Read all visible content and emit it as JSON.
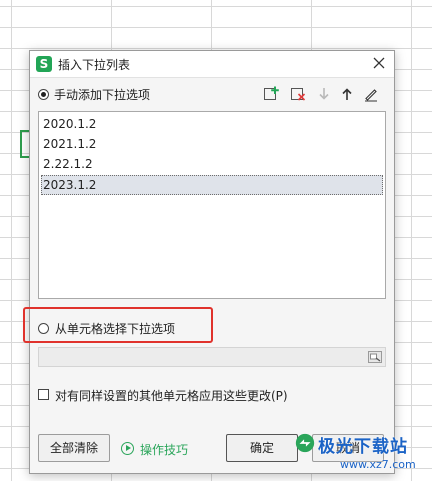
{
  "dialog": {
    "title": "插入下拉列表",
    "app_icon_letter": "S",
    "manual_option_label": "手动添加下拉选项",
    "manual_option_checked": true,
    "toolbar": {
      "icons": [
        "add-item-icon",
        "delete-item-icon",
        "move-down-icon",
        "move-up-icon",
        "edit-item-icon"
      ]
    },
    "items": [
      {
        "label": "2020.1.2",
        "selected": false
      },
      {
        "label": "2021.1.2",
        "selected": false
      },
      {
        "label": "2.22.1.2",
        "selected": false
      },
      {
        "label": "2023.1.2",
        "selected": true
      }
    ],
    "cell_option_label": "从单元格选择下拉选项",
    "cell_option_checked": false,
    "range_value": "",
    "apply_all_label": "对有同样设置的其他单元格应用这些更改(P)",
    "apply_all_checked": false,
    "clear_all_label": "全部清除",
    "tips_label": "操作技巧",
    "ok_label": "确定",
    "cancel_label": "取消"
  },
  "watermark": {
    "brand": "极光下载站",
    "url": "www.xz7.com"
  },
  "colors": {
    "accent_green": "#22a556",
    "highlight_red": "#e0322c",
    "selected_row": "#dfe3ea",
    "watermark_blue": "#1b63c6"
  }
}
